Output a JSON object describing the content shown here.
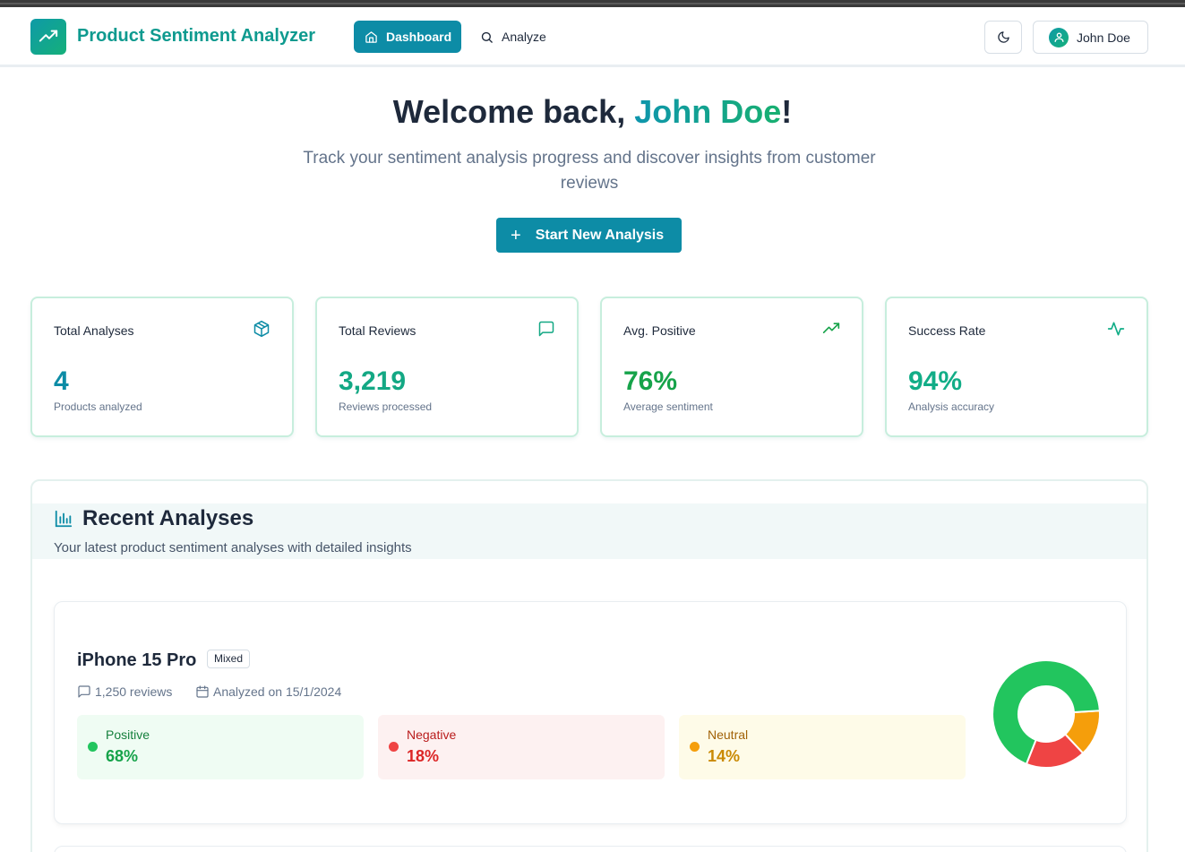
{
  "app": {
    "title": "Product Sentiment Analyzer",
    "logo_icon": "trending-up-icon"
  },
  "nav": {
    "dashboard_label": "Dashboard",
    "dashboard_icon": "home-icon",
    "analyze_label": "Analyze",
    "analyze_icon": "search-icon"
  },
  "user": {
    "name": "John Doe",
    "theme_icon": "moon-icon",
    "avatar_icon": "user-icon"
  },
  "hero": {
    "welcome_prefix": "Welcome back, ",
    "welcome_name": "John Doe",
    "welcome_suffix": "!",
    "subtitle": "Track your sentiment analysis progress and discover insights from customer reviews",
    "cta_icon": "+",
    "cta_label": "Start New Analysis"
  },
  "stats": [
    {
      "label": "Total Analyses",
      "value": "4",
      "desc": "Products analyzed",
      "icon": "package-icon",
      "color": "#0d8ca6"
    },
    {
      "label": "Total Reviews",
      "value": "3,219",
      "desc": "Reviews processed",
      "icon": "message-square-icon",
      "color": "#13a884"
    },
    {
      "label": "Avg. Positive",
      "value": "76%",
      "desc": "Average sentiment",
      "icon": "trending-up-icon",
      "color": "#16a34a"
    },
    {
      "label": "Success Rate",
      "value": "94%",
      "desc": "Analysis accuracy",
      "icon": "activity-icon",
      "color": "#12ad87"
    }
  ],
  "recent": {
    "title": "Recent Analyses",
    "subtitle": "Your latest product sentiment analyses with detailed insights",
    "icon": "bar-chart-icon",
    "items": [
      {
        "name": "iPhone 15 Pro",
        "badge": "Mixed",
        "reviews": "1,250 reviews",
        "analyzed": "Analyzed on 15/1/2024",
        "sentiments": [
          {
            "label": "Positive",
            "value": "68%",
            "fraction": 0.68,
            "color": "#22c55e"
          },
          {
            "label": "Negative",
            "value": "18%",
            "fraction": 0.18,
            "color": "#ef4444"
          },
          {
            "label": "Neutral",
            "value": "14%",
            "fraction": 0.14,
            "color": "#f59e0b"
          }
        ]
      }
    ]
  }
}
